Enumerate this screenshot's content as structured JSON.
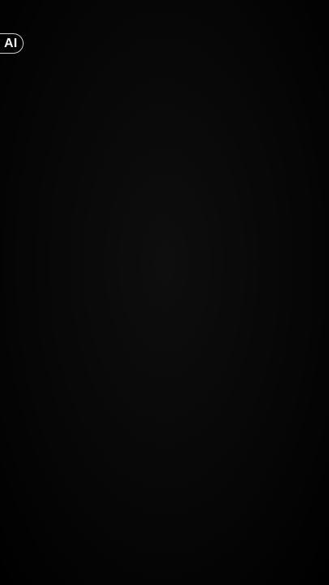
{
  "badge": {
    "label": "AI"
  },
  "colors": {
    "background": "#040404",
    "badge_border": "#cfcfcf",
    "badge_text": "#f2f2f2"
  }
}
